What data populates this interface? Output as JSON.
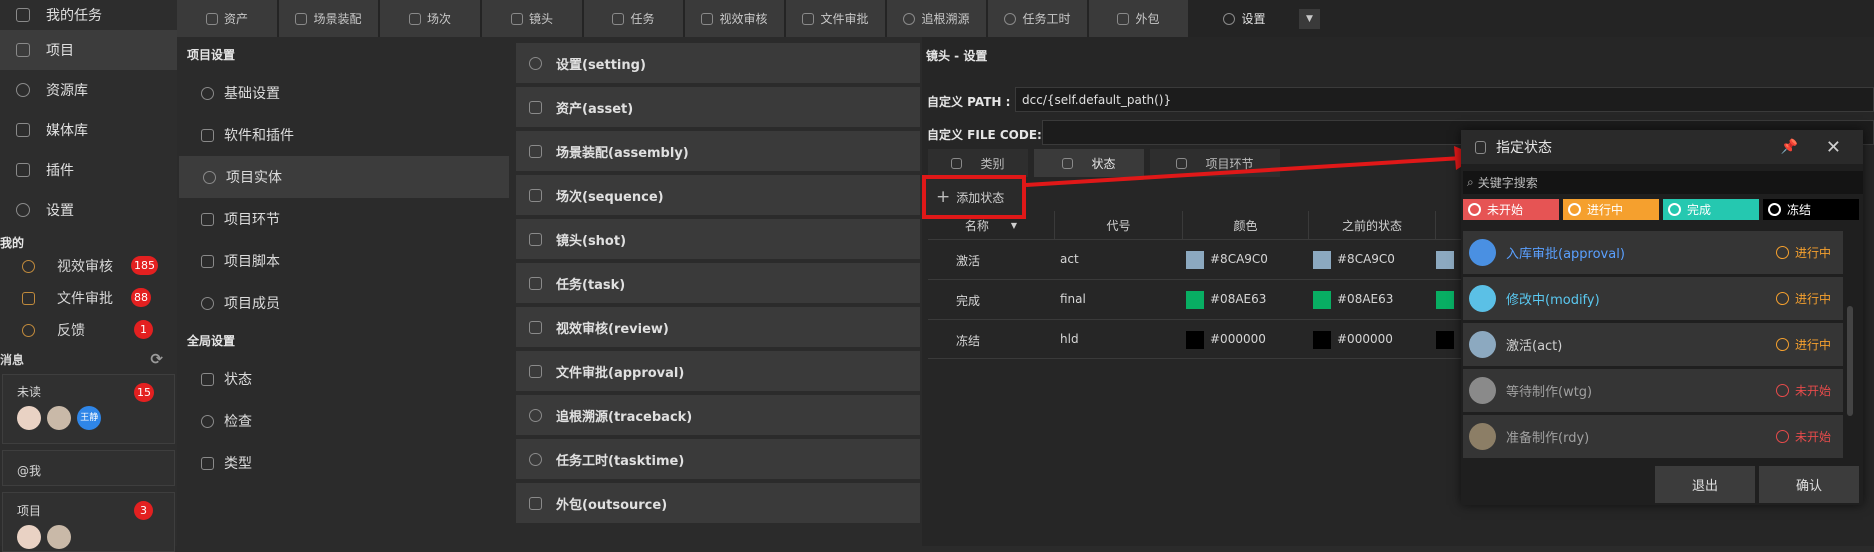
{
  "sidebar": {
    "nav": [
      {
        "label": "我的任务",
        "icon": "checkbox-icon"
      },
      {
        "label": "项目",
        "icon": "project-icon"
      },
      {
        "label": "资源库",
        "icon": "library-icon"
      },
      {
        "label": "媒体库",
        "icon": "media-icon"
      },
      {
        "label": "插件",
        "icon": "plugin-icon"
      },
      {
        "label": "设置",
        "icon": "gear-icon"
      }
    ],
    "mine_title": "我的",
    "quick": [
      {
        "label": "视效审核",
        "count": "185",
        "icon": "eye-icon"
      },
      {
        "label": "文件审批",
        "count": "88",
        "icon": "folder-icon"
      },
      {
        "label": "反馈",
        "count": "1",
        "icon": "warning-icon"
      }
    ],
    "messages_title": "消息",
    "unread_label": "未读",
    "unread_count": "15",
    "avatar_text": "王静",
    "at_me_label": "@我",
    "project_label": "项目",
    "project_count": "3"
  },
  "topbar": {
    "tabs": [
      "资产",
      "场景装配",
      "场次",
      "镜头",
      "任务",
      "视效审核",
      "文件审批",
      "追根溯源",
      "任务工时",
      "外包"
    ],
    "settings_tab": "设置"
  },
  "settings_panel": {
    "project_title": "项目设置",
    "project_items": [
      "基础设置",
      "软件和插件",
      "项目实体",
      "项目环节",
      "项目脚本",
      "项目成员"
    ],
    "global_title": "全局设置",
    "global_items": [
      "状态",
      "检查",
      "类型"
    ]
  },
  "entities": [
    "设置(setting)",
    "资产(asset)",
    "场景装配(assembly)",
    "场次(sequence)",
    "镜头(shot)",
    "任务(task)",
    "视效审核(review)",
    "文件审批(approval)",
    "追根溯源(traceback)",
    "任务工时(tasktime)",
    "外包(outsource)"
  ],
  "main": {
    "breadcrumb": "镜头 - 设置",
    "path_label": "自定义 PATH :",
    "path_value": "dcc/{self.default_path()}",
    "filecode_label": "自定义 FILE CODE:",
    "filecode_value": "",
    "subtabs": [
      "类别",
      "状态",
      "项目环节"
    ],
    "add_status": "添加状态",
    "columns": [
      "名称",
      "代号",
      "颜色",
      "之前的状态"
    ],
    "rows": [
      {
        "name": "激活",
        "code": "act",
        "color": "#8CA9C0",
        "prev": "#8CA9C0"
      },
      {
        "name": "完成",
        "code": "final",
        "color": "#08AE63",
        "prev": "#08AE63"
      },
      {
        "name": "冻结",
        "code": "hld",
        "color": "#000000",
        "prev": "#000000"
      }
    ]
  },
  "popup": {
    "title": "指定状态",
    "search_placeholder": "关键字搜索",
    "filters": [
      {
        "label": "未开始",
        "color": "#e65454"
      },
      {
        "label": "进行中",
        "color": "#f5a02e"
      },
      {
        "label": "完成",
        "color": "#25c8b0"
      },
      {
        "label": "冻结",
        "color": "#000000"
      }
    ],
    "statuses": [
      {
        "name": "入库审批(approval)",
        "state": "进行中",
        "dot": "#4a90e2",
        "text_color": "#5aa0ff"
      },
      {
        "name": "修改中(modify)",
        "state": "进行中",
        "dot": "#5bc0e6",
        "text_color": "#5ac8f0"
      },
      {
        "name": "激活(act)",
        "state": "进行中",
        "dot": "#8CA9C0",
        "text_color": "#d0d0d0"
      },
      {
        "name": "等待制作(wtg)",
        "state": "未开始",
        "dot": "#8a8a8a",
        "text_color": "#a0a0a0"
      },
      {
        "name": "准备制作(rdy)",
        "state": "未开始",
        "dot": "#8c7e66",
        "text_color": "#a0a0a0"
      }
    ],
    "state_colors": {
      "进行中": "#f5a02e",
      "未开始": "#e64b4b"
    },
    "cancel_label": "退出",
    "confirm_label": "确认"
  }
}
